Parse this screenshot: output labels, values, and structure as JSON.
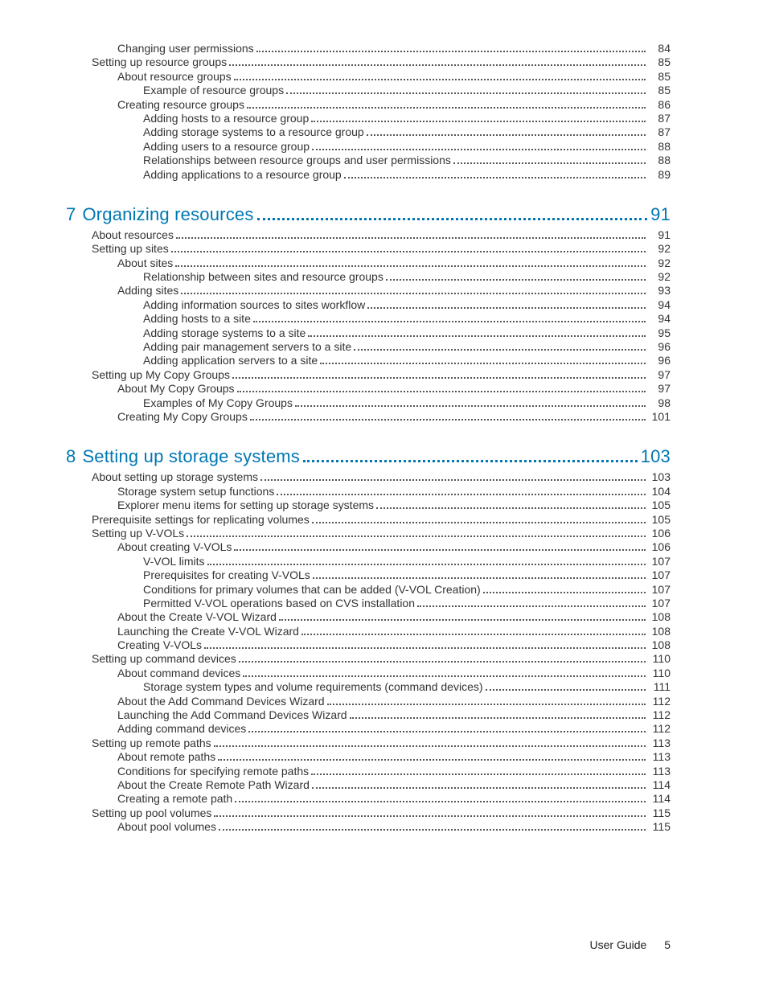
{
  "footer": {
    "label": "User Guide",
    "page": "5"
  },
  "pre_entries": [
    {
      "level": 2,
      "title": "Changing user permissions",
      "page": "84"
    },
    {
      "level": 1,
      "title": "Setting up resource groups",
      "page": "85"
    },
    {
      "level": 2,
      "title": "About resource groups",
      "page": "85"
    },
    {
      "level": 3,
      "title": "Example of resource groups",
      "page": "85"
    },
    {
      "level": 2,
      "title": "Creating resource groups",
      "page": "86"
    },
    {
      "level": 3,
      "title": "Adding hosts to a resource group",
      "page": "87"
    },
    {
      "level": 3,
      "title": "Adding storage systems to a resource group",
      "page": "87"
    },
    {
      "level": 3,
      "title": "Adding users to a resource group",
      "page": "88"
    },
    {
      "level": 3,
      "title": "Relationships between resource groups and user permissions",
      "page": "88"
    },
    {
      "level": 3,
      "title": "Adding applications to a resource group",
      "page": "89"
    }
  ],
  "chapter7": {
    "num": "7",
    "title": "Organizing resources",
    "page": "91"
  },
  "ch7_entries": [
    {
      "level": 1,
      "title": "About resources",
      "page": "91"
    },
    {
      "level": 1,
      "title": "Setting up sites",
      "page": "92"
    },
    {
      "level": 2,
      "title": "About sites",
      "page": "92"
    },
    {
      "level": 3,
      "title": "Relationship between sites and resource groups",
      "page": "92"
    },
    {
      "level": 2,
      "title": "Adding sites",
      "page": "93"
    },
    {
      "level": 3,
      "title": "Adding information sources to sites workflow",
      "page": "94"
    },
    {
      "level": 3,
      "title": "Adding hosts to a site",
      "page": "94"
    },
    {
      "level": 3,
      "title": "Adding storage systems to a site",
      "page": "95"
    },
    {
      "level": 3,
      "title": "Adding pair management servers to a site",
      "page": "96"
    },
    {
      "level": 3,
      "title": "Adding application servers to a site",
      "page": "96"
    },
    {
      "level": 1,
      "title": "Setting up My Copy Groups",
      "page": "97"
    },
    {
      "level": 2,
      "title": "About My Copy Groups",
      "page": "97"
    },
    {
      "level": 3,
      "title": "Examples of My Copy Groups",
      "page": "98"
    },
    {
      "level": 2,
      "title": "Creating My Copy Groups",
      "page": "101"
    }
  ],
  "chapter8": {
    "num": "8",
    "title": "Setting up storage systems",
    "page": "103"
  },
  "ch8_entries": [
    {
      "level": 1,
      "title": "About setting up storage systems",
      "page": "103"
    },
    {
      "level": 2,
      "title": "Storage system setup functions",
      "page": "104"
    },
    {
      "level": 2,
      "title": "Explorer menu items for setting up storage systems",
      "page": "105"
    },
    {
      "level": 1,
      "title": "Prerequisite settings for replicating volumes",
      "page": "105"
    },
    {
      "level": 1,
      "title": "Setting up V-VOLs",
      "page": "106"
    },
    {
      "level": 2,
      "title": "About creating V-VOLs",
      "page": "106"
    },
    {
      "level": 3,
      "title": "V-VOL limits",
      "page": "107"
    },
    {
      "level": 3,
      "title": "Prerequisites for creating V-VOLs",
      "page": "107"
    },
    {
      "level": 3,
      "title": "Conditions for primary volumes that can be added (V-VOL Creation)",
      "page": "107"
    },
    {
      "level": 3,
      "title": "Permitted V-VOL operations based on CVS installation",
      "page": "107"
    },
    {
      "level": 2,
      "title": "About the Create V-VOL Wizard",
      "page": "108"
    },
    {
      "level": 2,
      "title": "Launching the Create V-VOL Wizard",
      "page": "108"
    },
    {
      "level": 2,
      "title": "Creating V-VOLs",
      "page": "108"
    },
    {
      "level": 1,
      "title": "Setting up command devices",
      "page": "110"
    },
    {
      "level": 2,
      "title": "About command devices",
      "page": "110"
    },
    {
      "level": 3,
      "title": "Storage system types and volume requirements (command devices)",
      "page": "111"
    },
    {
      "level": 2,
      "title": "About the Add Command Devices Wizard",
      "page": "112"
    },
    {
      "level": 2,
      "title": "Launching the Add Command Devices Wizard",
      "page": "112"
    },
    {
      "level": 2,
      "title": "Adding command devices",
      "page": "112"
    },
    {
      "level": 1,
      "title": "Setting up remote paths",
      "page": "113"
    },
    {
      "level": 2,
      "title": "About remote paths",
      "page": "113"
    },
    {
      "level": 2,
      "title": "Conditions for specifying remote paths",
      "page": "113"
    },
    {
      "level": 2,
      "title": "About the Create Remote Path Wizard",
      "page": "114"
    },
    {
      "level": 2,
      "title": "Creating a remote path",
      "page": "114"
    },
    {
      "level": 1,
      "title": "Setting up pool volumes",
      "page": "115"
    },
    {
      "level": 2,
      "title": "About pool volumes",
      "page": "115"
    }
  ]
}
